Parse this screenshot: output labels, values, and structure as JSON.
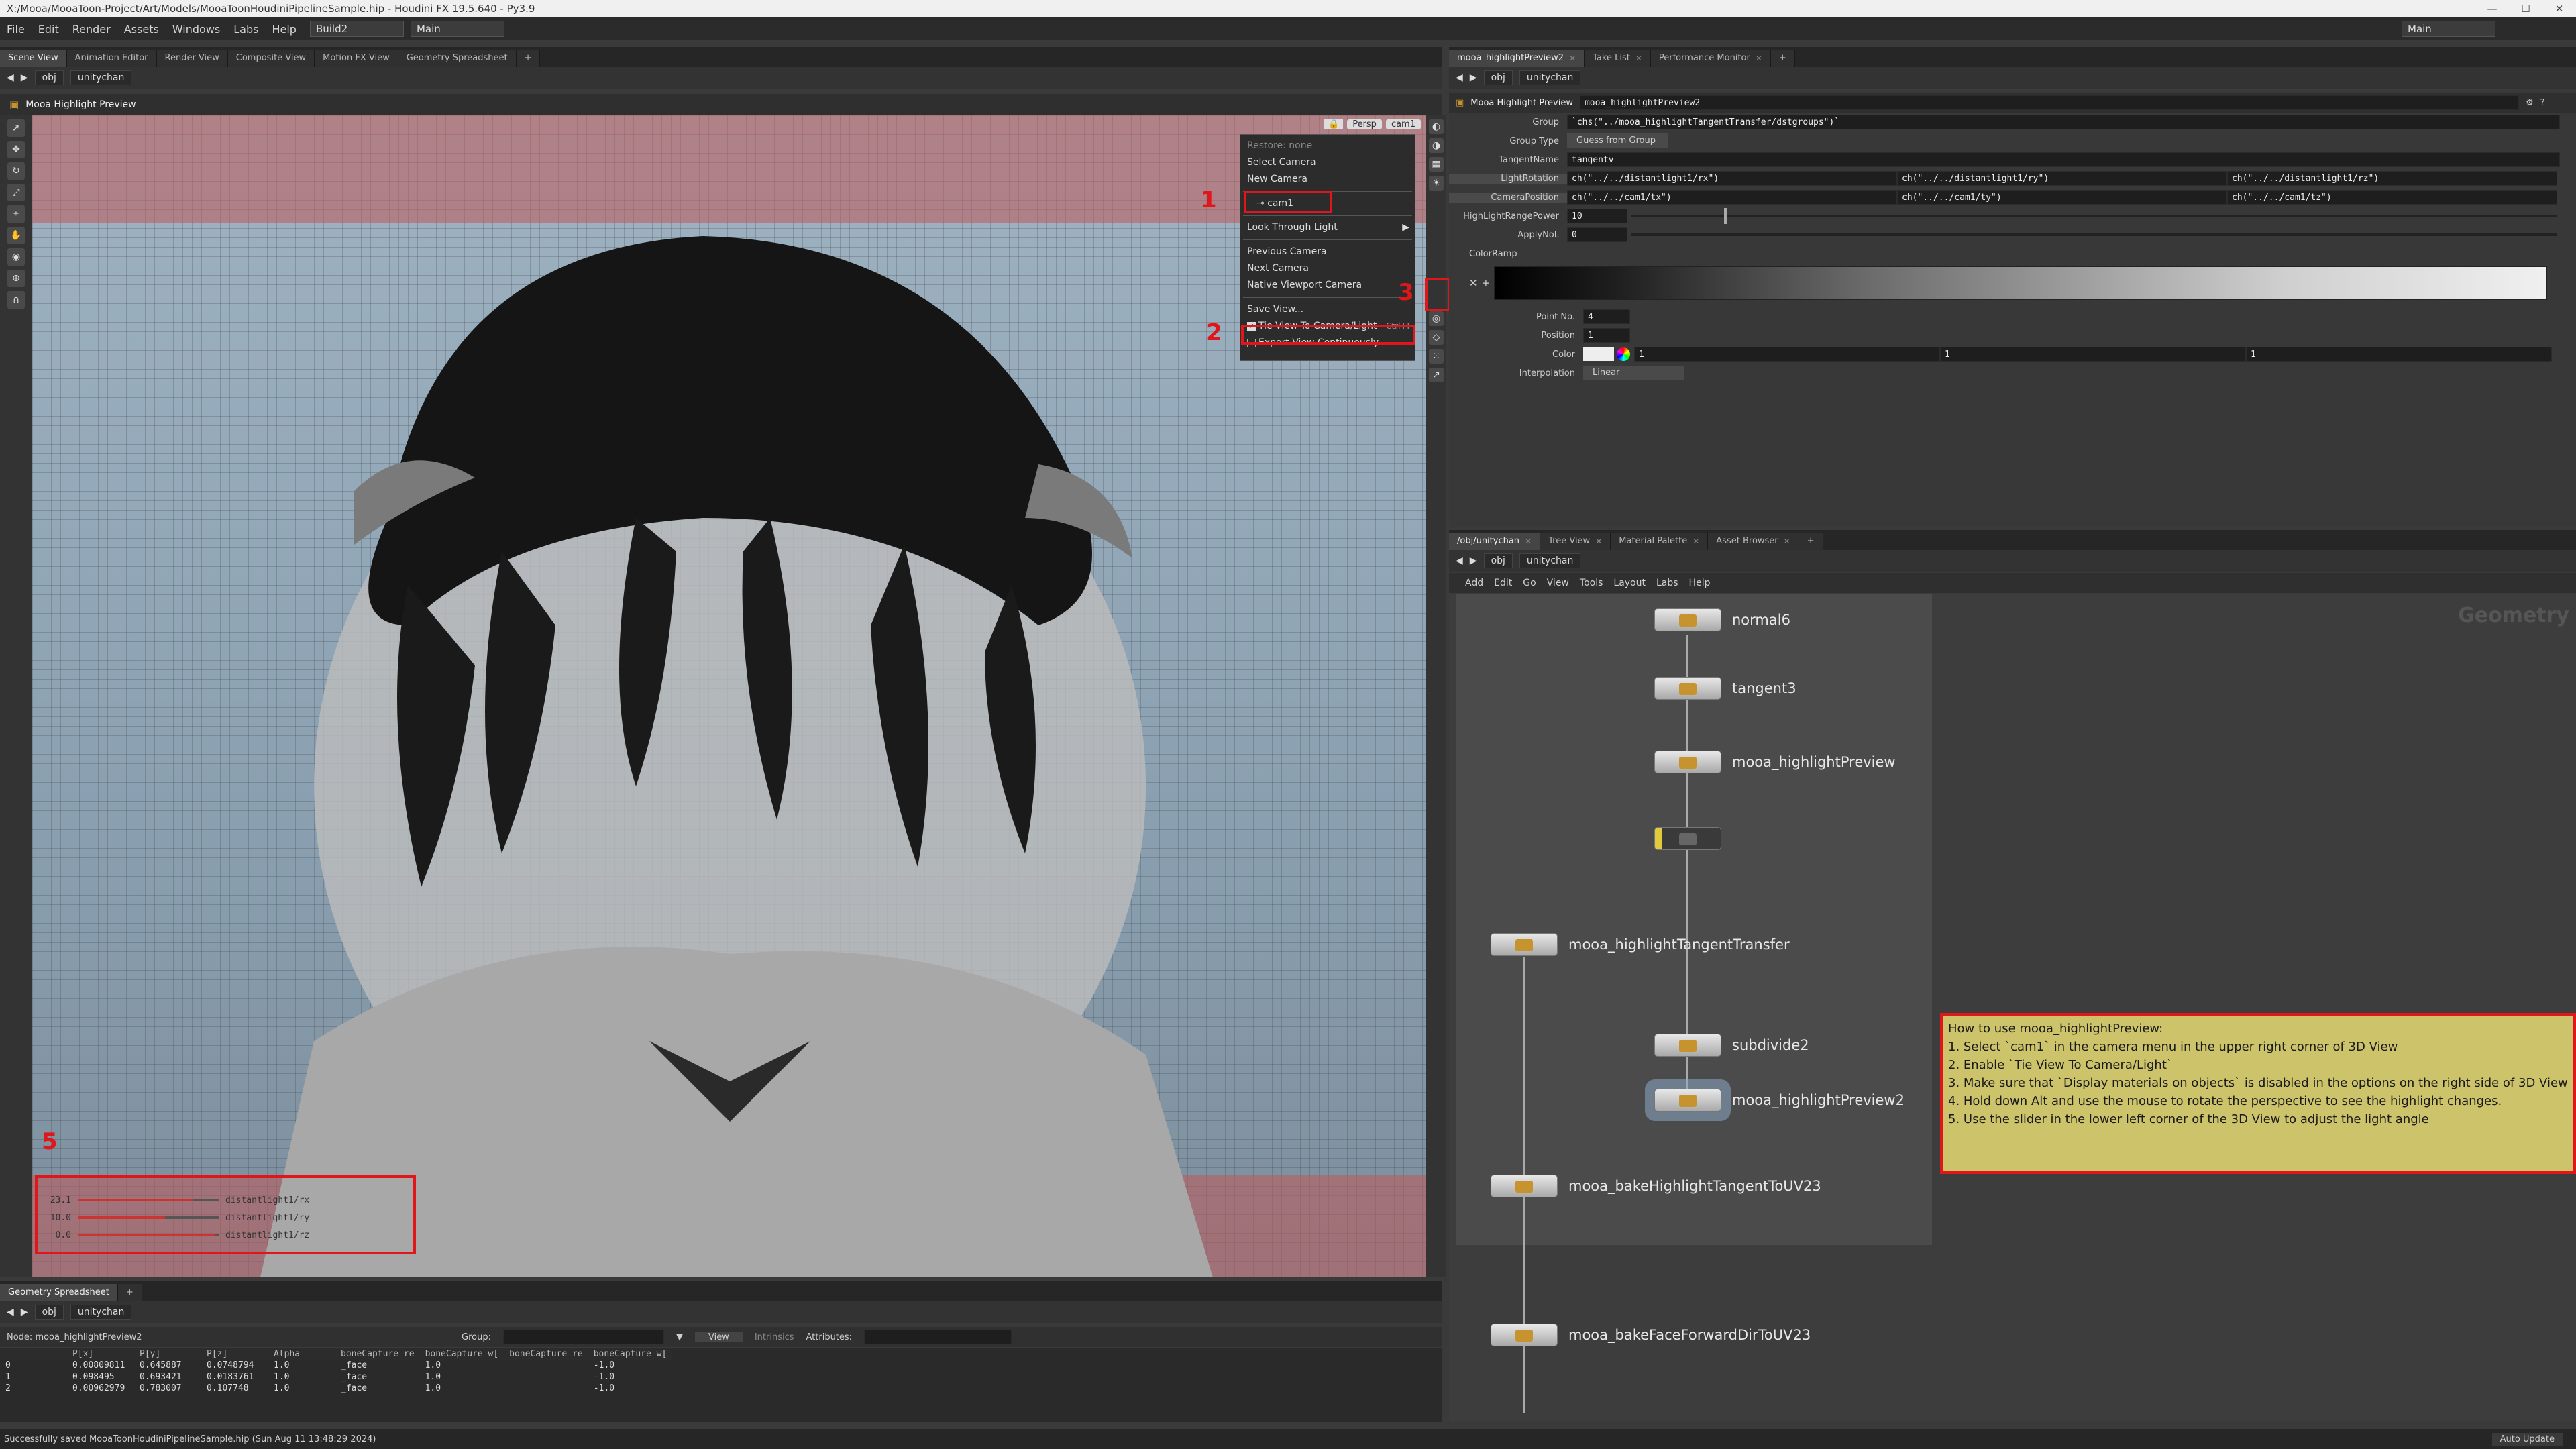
{
  "app": {
    "title": "X:/Mooa/MooaToon-Project/Art/Models/MooaToonHoudiniPipelineSample.hip - Houdini FX 19.5.640 - Py3.9",
    "menu": [
      "File",
      "Edit",
      "Render",
      "Assets",
      "Windows",
      "Labs",
      "Help"
    ],
    "build_label": "Build2",
    "desktop_label": "Main",
    "desktop_right": "Main"
  },
  "left_tabs": [
    "Scene View",
    "Animation Editor",
    "Render View",
    "Composite View",
    "Motion FX View",
    "Geometry Spreadsheet"
  ],
  "path": {
    "obj": "obj",
    "node": "unitychan"
  },
  "viewport": {
    "title": "Mooa Highlight Preview",
    "persp": "Persp",
    "cam": "cam1",
    "sliders": [
      {
        "val": "23.1",
        "label": "distantlight1/rx",
        "frac": 0.82
      },
      {
        "val": "10.0",
        "label": "distantlight1/ry",
        "frac": 0.62
      },
      {
        "val": "0.0",
        "label": "distantlight1/rz",
        "frac": 0.97
      }
    ]
  },
  "cam_menu": {
    "restore": "Restore: none",
    "select": "Select Camera",
    "new": "New Camera",
    "cam": "cam1",
    "look": "Look Through Light",
    "prev": "Previous Camera",
    "next": "Next Camera",
    "native": "Native Viewport Camera",
    "save": "Save View...",
    "tie": "Tie View To Camera/Light",
    "tie_shortcut": "Ctrl+I",
    "export": "Export View Continuously"
  },
  "annotations": {
    "n1": "1",
    "n2": "2",
    "n3": "3",
    "n5": "5"
  },
  "params": {
    "tabs": [
      "mooa_highlightPreview2",
      "Take List",
      "Performance Monitor"
    ],
    "title": "Mooa Highlight Preview",
    "node_name": "mooa_highlightPreview2",
    "group_label": "Group",
    "group_value": "`chs(\"../mooa_highlightTangentTransfer/dstgroups\")`",
    "grouptype_label": "Group Type",
    "grouptype_value": "Guess from Group",
    "tangent_label": "TangentName",
    "tangent_value": "tangentv",
    "light_label": "LightRotation",
    "light_x": "ch(\"../../distantlight1/rx\")",
    "light_y": "ch(\"../../distantlight1/ry\")",
    "light_z": "ch(\"../../distantlight1/rz\")",
    "cam_label": "CameraPosition",
    "cam_x": "ch(\"../../cam1/tx\")",
    "cam_y": "ch(\"../../cam1/ty\")",
    "cam_z": "ch(\"../../cam1/tz\")",
    "power_label": "HighLightRangePower",
    "power_value": "10",
    "power_frac": 0.1,
    "applynol_label": "ApplyNoL",
    "applynol_value": "0",
    "ramp_label": "ColorRamp",
    "point_label": "Point No.",
    "point_value": "4",
    "pos_label": "Position",
    "pos_value": "1",
    "color_label": "Color",
    "color_r": "1",
    "color_g": "1",
    "color_b": "1",
    "interp_label": "Interpolation",
    "interp_value": "Linear"
  },
  "network": {
    "tabs": [
      "/obj/unitychan",
      "Tree View",
      "Material Palette",
      "Asset Browser"
    ],
    "menu": [
      "Add",
      "Edit",
      "Go",
      "View",
      "Tools",
      "Layout",
      "Labs",
      "Help"
    ],
    "context": "Geometry",
    "nodes": {
      "n1": "normal6",
      "n2": "tangent3",
      "n3": "mooa_highlightPreview",
      "n4": "mooa_highlightTangentTransfer",
      "n5": "subdivide2",
      "n6": "mooa_highlightPreview2",
      "n7": "mooa_bakeHighlightTangentToUV23",
      "n8": "mooa_bakeFaceForwardDirToUV23"
    },
    "note": [
      "How to use mooa_highlightPreview:",
      "1. Select `cam1` in the camera menu in the upper right corner of 3D View",
      "2. Enable `Tie View To Camera/Light`",
      "3. Make sure that `Display materials on objects` is disabled in the options on the right side of 3D View",
      "4. Hold down Alt and use the mouse to rotate the perspective to see the highlight changes.",
      "5. Use the slider in the lower left corner of the 3D View to adjust the light angle"
    ]
  },
  "spreadsheet": {
    "tab": "Geometry Spreadsheet",
    "node_label": "Node: mooa_highlightPreview2",
    "group_label": "Group:",
    "view_label": "View",
    "intrinsic": "Intrinsics",
    "attributes": "Attributes:",
    "headers": [
      "",
      "P[x]",
      "P[y]",
      "P[z]",
      "Alpha",
      "boneCapture re",
      "boneCapture w[",
      "boneCapture re",
      "boneCapture w["
    ],
    "rows": [
      [
        "0",
        "0.00809811",
        "0.645887",
        "0.0748794",
        "1.0",
        "_face",
        "1.0",
        "",
        "-1.0"
      ],
      [
        "1",
        "0.098495",
        "0.693421",
        "0.0183761",
        "1.0",
        "_face",
        "1.0",
        "",
        "-1.0"
      ],
      [
        "2",
        "0.00962979",
        "0.783007",
        "0.107748",
        "1.0",
        "_face",
        "1.0",
        "",
        "-1.0"
      ]
    ]
  },
  "status": {
    "text": "Successfully saved MooaToonHoudiniPipelineSample.hip (Sun Aug 11 13:48:29 2024)",
    "auto": "Auto Update"
  },
  "colors": {
    "accent": "#e0161b",
    "note_bg": "#cdc36a"
  }
}
